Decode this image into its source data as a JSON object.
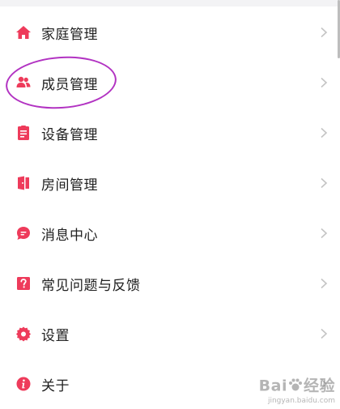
{
  "menu": {
    "items": [
      {
        "label": "家庭管理",
        "icon": "home-icon"
      },
      {
        "label": "成员管理",
        "icon": "members-icon"
      },
      {
        "label": "设备管理",
        "icon": "device-list-icon"
      },
      {
        "label": "房间管理",
        "icon": "door-icon"
      },
      {
        "label": "消息中心",
        "icon": "message-icon"
      },
      {
        "label": "常见问题与反馈",
        "icon": "question-icon"
      },
      {
        "label": "设置",
        "icon": "gear-icon"
      },
      {
        "label": "关于",
        "icon": "info-icon"
      }
    ]
  },
  "watermark": {
    "brand": "Bai",
    "brand_suffix": "经验",
    "site": "jingyan.baidu.com"
  },
  "colors": {
    "accent": "#ee3b5b",
    "annotation": "#b233c2",
    "chevron": "#c4c4c4"
  }
}
